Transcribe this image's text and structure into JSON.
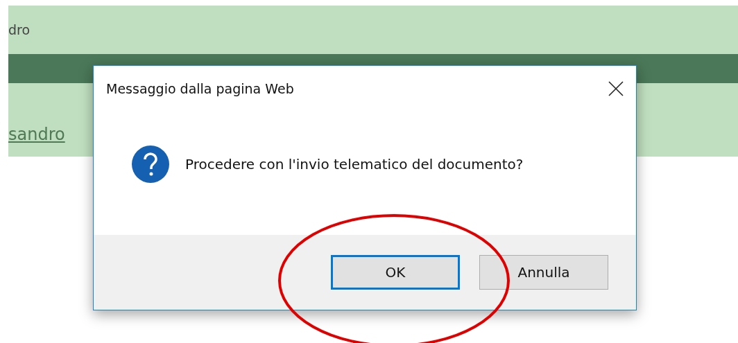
{
  "page": {
    "top_text": "dro",
    "link": "sandro"
  },
  "dialog": {
    "title": "Messaggio dalla pagina Web",
    "message": "Procedere con l'invio telematico del documento?",
    "buttons": [
      {
        "label": "OK",
        "default": true
      },
      {
        "label": "Annulla",
        "default": false
      }
    ]
  },
  "annotation": {
    "kind": "ellipse"
  }
}
